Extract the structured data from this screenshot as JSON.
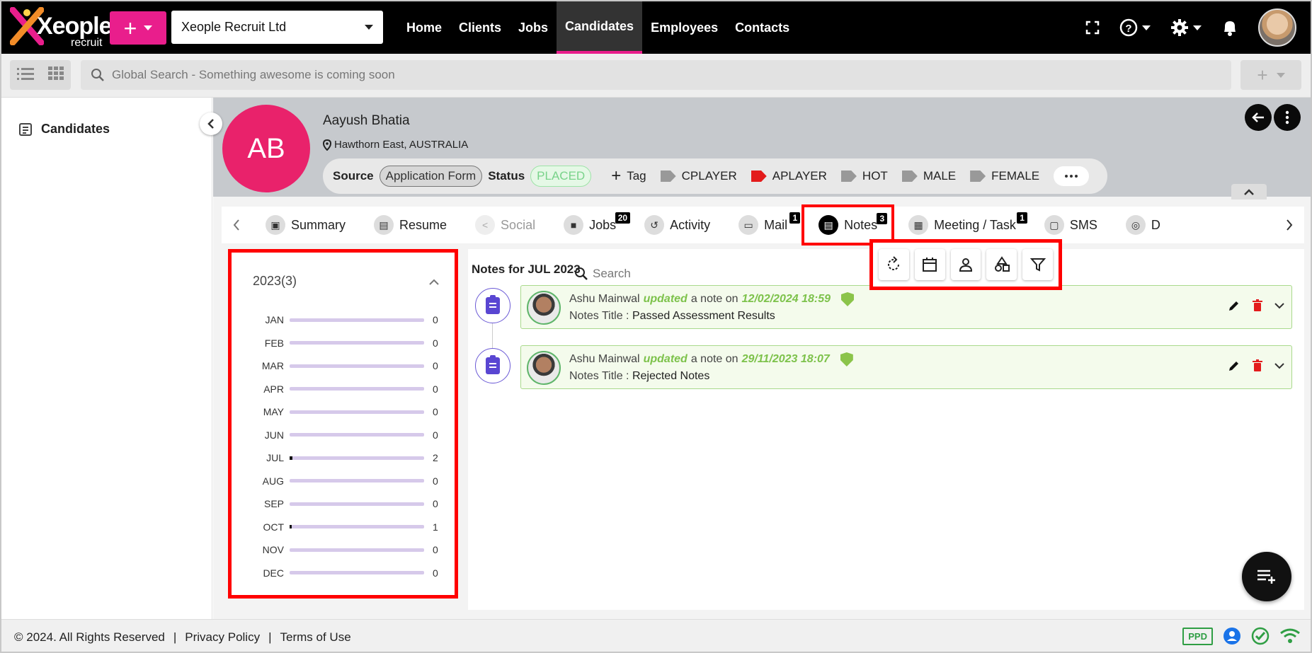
{
  "app": {
    "logo_word": "Xeople",
    "logo_sub": "recruit",
    "company": "Xeople Recruit Ltd",
    "nav": [
      "Home",
      "Clients",
      "Jobs",
      "Candidates",
      "Employees",
      "Contacts"
    ],
    "accent": "#e91e8c"
  },
  "search": {
    "placeholder": "Global Search - Something awesome is coming soon"
  },
  "sidebar": {
    "items": [
      {
        "label": "Candidates"
      }
    ]
  },
  "candidate": {
    "initials": "AB",
    "name": "Aayush Bhatia",
    "location": "Hawthorn East, AUSTRALIA",
    "source_label": "Source",
    "source_value": "Application Form",
    "status_label": "Status",
    "status_value": "PLACED",
    "tag_add": "Tag",
    "tags": [
      "CPLAYER",
      "APLAYER",
      "HOT",
      "MALE",
      "FEMALE"
    ]
  },
  "tabs": {
    "items": [
      {
        "label": "Summary",
        "badge": ""
      },
      {
        "label": "Resume",
        "badge": ""
      },
      {
        "label": "Social",
        "badge": ""
      },
      {
        "label": "Jobs",
        "badge": "20"
      },
      {
        "label": "Activity",
        "badge": ""
      },
      {
        "label": "Mail",
        "badge": "1"
      },
      {
        "label": "Notes",
        "badge": "3"
      },
      {
        "label": "Meeting / Task",
        "badge": "1"
      },
      {
        "label": "SMS",
        "badge": ""
      },
      {
        "label": "D",
        "badge": ""
      }
    ]
  },
  "months_panel": {
    "year": "2023(3)",
    "months": [
      {
        "name": "JAN",
        "count": "0",
        "fill": 0
      },
      {
        "name": "FEB",
        "count": "0",
        "fill": 0
      },
      {
        "name": "MAR",
        "count": "0",
        "fill": 0
      },
      {
        "name": "APR",
        "count": "0",
        "fill": 0
      },
      {
        "name": "MAY",
        "count": "0",
        "fill": 0
      },
      {
        "name": "JUN",
        "count": "0",
        "fill": 0
      },
      {
        "name": "JUL",
        "count": "2",
        "fill": 0.02
      },
      {
        "name": "AUG",
        "count": "0",
        "fill": 0
      },
      {
        "name": "SEP",
        "count": "0",
        "fill": 0
      },
      {
        "name": "OCT",
        "count": "1",
        "fill": 0.01
      },
      {
        "name": "NOV",
        "count": "0",
        "fill": 0
      },
      {
        "name": "DEC",
        "count": "0",
        "fill": 0
      }
    ]
  },
  "notes": {
    "heading": "Notes for JUL 2023",
    "search_placeholder": "Search",
    "items": [
      {
        "author": "Ashu Mainwal",
        "action": "updated",
        "mid": "a note on",
        "datetime": "12/02/2024 18:59",
        "title_label": "Notes Title :",
        "title": "Passed Assessment Results"
      },
      {
        "author": "Ashu Mainwal",
        "action": "updated",
        "mid": "a note on",
        "datetime": "29/11/2023 18:07",
        "title_label": "Notes Title :",
        "title": "Rejected Notes"
      }
    ]
  },
  "footer": {
    "copyright": "© 2024. All Rights Reserved",
    "privacy": "Privacy Policy",
    "terms": "Terms of Use",
    "ppd": "PPD"
  }
}
